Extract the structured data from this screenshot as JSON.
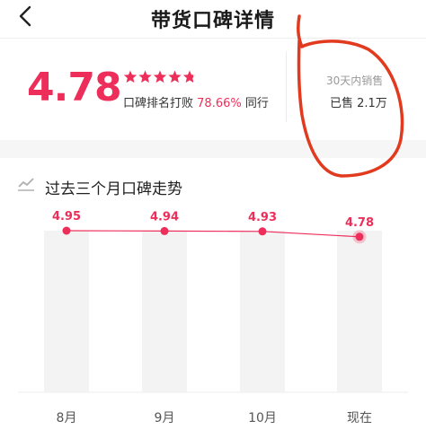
{
  "header": {
    "title": "带货口碑详情",
    "back_icon": "chevron-left-icon"
  },
  "summary": {
    "score": "4.78",
    "stars": {
      "rating": 4.78,
      "max": 5,
      "color": "#ee2e5a"
    },
    "rank_prefix": "口碑排名打败",
    "rank_pct": "78.66%",
    "rank_suffix": "同行",
    "sales_label": "30天内销售",
    "sales_value": "已售 2.1万"
  },
  "trend": {
    "title": "过去三个月口碑走势",
    "icon": "trend-line-icon"
  },
  "chart_data": {
    "type": "line",
    "categories": [
      "8月",
      "9月",
      "10月",
      "现在"
    ],
    "values": [
      4.95,
      4.94,
      4.93,
      4.78
    ],
    "value_labels": [
      "4.95",
      "4.94",
      "4.93",
      "4.78"
    ],
    "color": "#ee2e5a"
  },
  "colors": {
    "accent": "#ee2e5a",
    "annotation": "#e23a1e"
  }
}
